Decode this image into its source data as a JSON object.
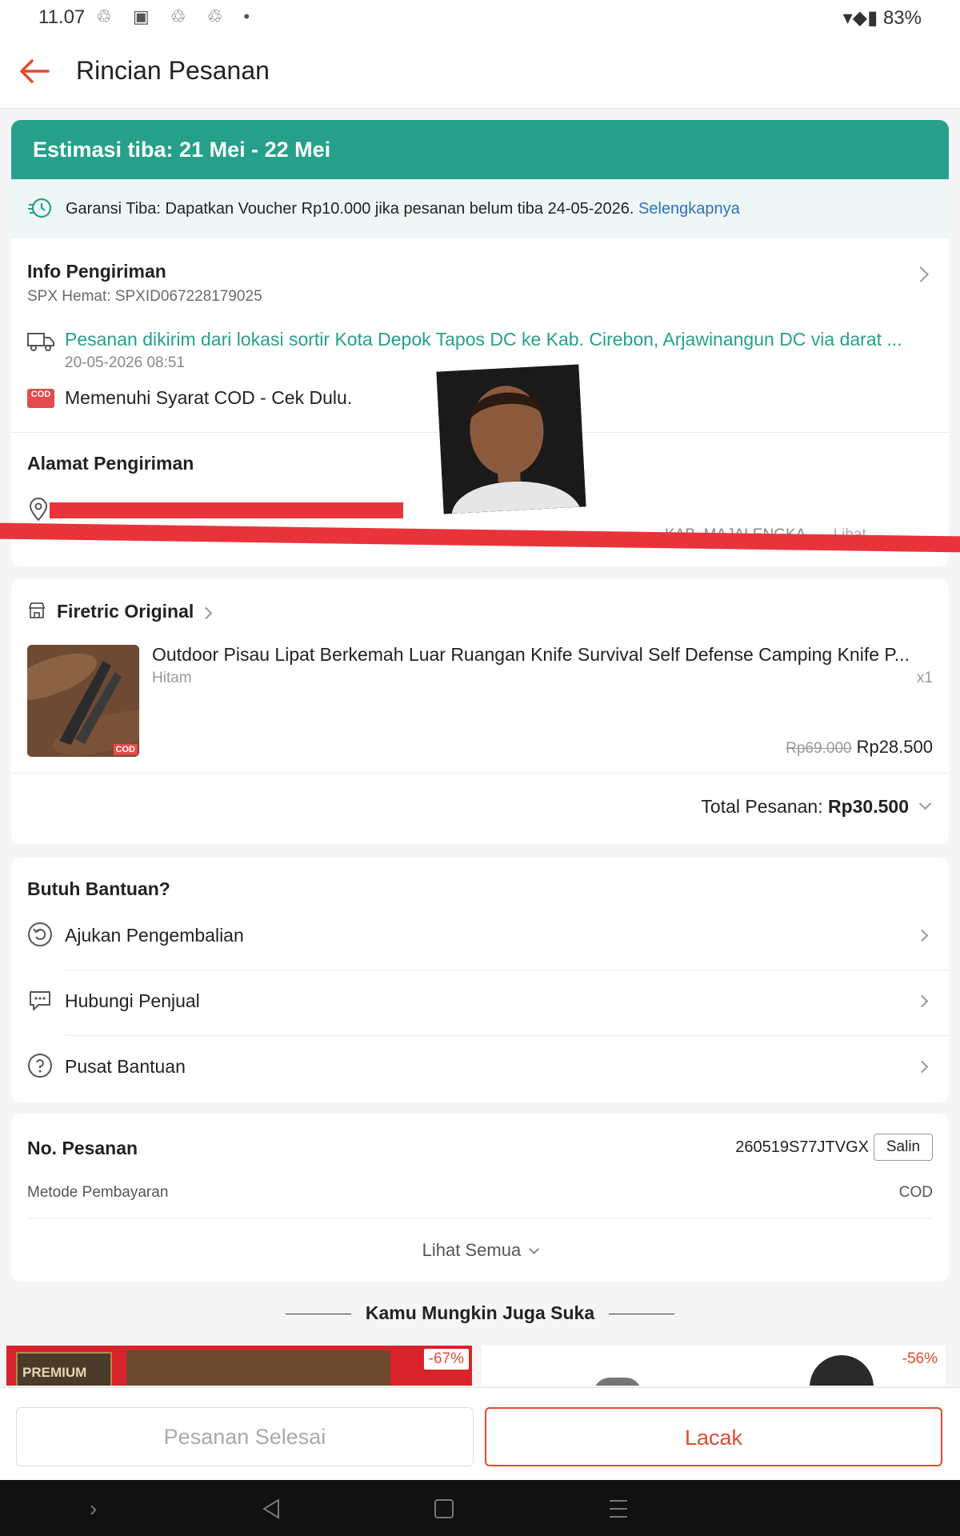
{
  "status": {
    "time": "11.07",
    "battery": "83%"
  },
  "header": {
    "title": "Rincian Pesanan"
  },
  "banner": {
    "text": "Estimasi tiba: 21 Mei - 22 Mei"
  },
  "garansi": {
    "text": "Garansi Tiba: Dapatkan Voucher Rp10.000 jika pesanan belum tiba 24-05-2026.",
    "link": "Selengkapnya"
  },
  "shipping": {
    "title": "Info Pengiriman",
    "code": "SPX Hemat: SPXID067228179025",
    "status": "Pesanan dikirim dari lokasi sortir Kota Depok  Tapos DC ke Kab. Cirebon, Arjawinangun DC via darat ...",
    "timestamp": "20-05-2026 08:51",
    "cod_badge": "COD",
    "cod_text": "Memenuhi Syarat COD - Cek Dulu.",
    "address_title": "Alamat Pengiriman",
    "address_name": "",
    "address_line": "KAB. MAJALENGKA",
    "address_more": "Lihat"
  },
  "shop": {
    "name": "Firetric Original",
    "product_name": "Outdoor Pisau Lipat Berkemah Luar Ruangan Knife Survival Self Defense Camping Knife P...",
    "variant": "Hitam",
    "qty": "x1",
    "price_old": "Rp69.000",
    "price": "Rp28.500",
    "total_label": "Total Pesanan:",
    "total_value": "Rp30.500",
    "img_badge": "COD"
  },
  "help": {
    "title": "Butuh Bantuan?",
    "items": [
      {
        "label": "Ajukan Pengembalian"
      },
      {
        "label": "Hubungi Penjual"
      },
      {
        "label": "Pusat Bantuan"
      }
    ]
  },
  "order": {
    "label": "No. Pesanan",
    "number": "260519S77JTVGX",
    "copy": "Salin",
    "payment_label": "Metode Pembayaran",
    "payment_value": "COD",
    "see_all": "Lihat Semua"
  },
  "recommend": {
    "title": "Kamu Mungkin Juga Suka",
    "items": [
      {
        "discount": "-67%",
        "tag": "PREMIUM"
      },
      {
        "discount": "-56%"
      }
    ]
  },
  "actions": {
    "done": "Pesanan Selesai",
    "track": "Lacak"
  },
  "colors": {
    "accent": "#e24b2e",
    "teal": "#26a08a",
    "link": "#2f6fbf"
  }
}
